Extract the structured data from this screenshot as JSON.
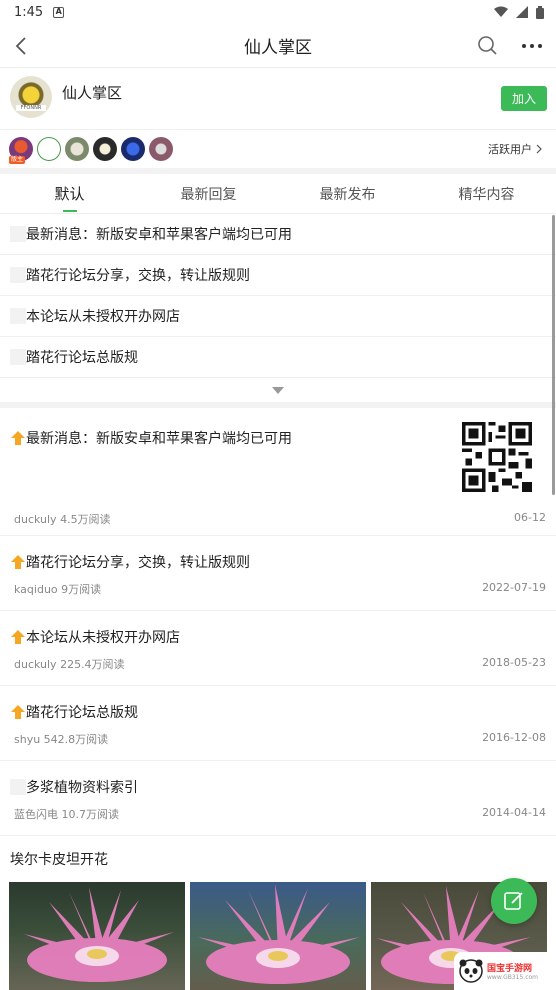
{
  "status_bar": {
    "time": "1:45"
  },
  "header": {
    "title": "仙人掌区"
  },
  "forum": {
    "name": "仙人掌区",
    "logo_text": "FFONNR",
    "join_label": "加入"
  },
  "users": {
    "badge": "版主",
    "active_label": "活跃用户"
  },
  "tabs": [
    {
      "label": "默认",
      "active": true
    },
    {
      "label": "最新回复",
      "active": false
    },
    {
      "label": "最新发布",
      "active": false
    },
    {
      "label": "精华内容",
      "active": false
    }
  ],
  "pinned": [
    {
      "title": "最新消息：新版安卓和苹果客户端均已可用"
    },
    {
      "title": "踏花行论坛分享，交换，转让版规则"
    },
    {
      "title": "本论坛从未授权开办网店"
    },
    {
      "title": "踏花行论坛总版规"
    }
  ],
  "posts": [
    {
      "title": "最新消息：新版安卓和苹果客户端均已可用",
      "meta": "duckuly 4.5万阅读",
      "date": "06-12",
      "icon": "up-arrow-icon"
    },
    {
      "title": "踏花行论坛分享，交换，转让版规则",
      "meta": "kaqiduo 9万阅读",
      "date": "2022-07-19",
      "icon": "up-arrow-icon"
    },
    {
      "title": "本论坛从未授权开办网店",
      "meta": "duckuly 225.4万阅读",
      "date": "2018-05-23",
      "icon": "up-arrow-icon"
    },
    {
      "title": "踏花行论坛总版规",
      "meta": "shyu 542.8万阅读",
      "date": "2016-12-08",
      "icon": "up-arrow-icon"
    },
    {
      "title": "多浆植物资料索引",
      "meta": "蓝色闪电 10.7万阅读",
      "date": "2014-04-14",
      "icon": ""
    }
  ],
  "photo_post": {
    "title": "埃尔卡皮坦开花"
  },
  "watermark": {
    "text": "国宝手游网",
    "sub": "www.GB315.com"
  },
  "colors": {
    "accent": "#3dba58",
    "pin_icon": "#f5a623"
  }
}
